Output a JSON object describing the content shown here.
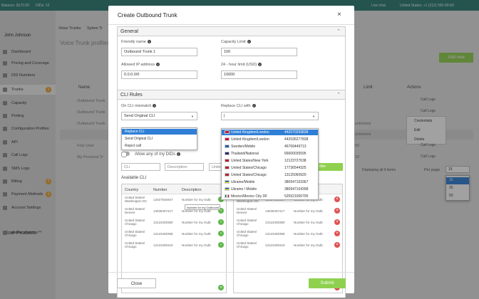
{
  "topbar": {
    "balance": "Balance: $170.00",
    "dids": "DIDs: 12",
    "live_chat": "Live chat",
    "phone": "United States: +1 (212) 555-90-60"
  },
  "sidebar": {
    "user": "John Johnson",
    "items": [
      {
        "label": "Dashboard"
      },
      {
        "label": "Pricing and Coverage"
      },
      {
        "label": "DID Numbers"
      },
      {
        "label": "Trunks",
        "badge": "1"
      },
      {
        "label": "Capacity"
      },
      {
        "label": "Porting"
      },
      {
        "label": "Configuration Profiles"
      },
      {
        "label": "API"
      },
      {
        "label": "Call Logs"
      },
      {
        "label": "SMS Logs"
      },
      {
        "label": "Billing",
        "badge": "2"
      },
      {
        "label": "Payment Methods",
        "badge": "1"
      },
      {
        "label": "Account Settings"
      }
    ],
    "more": "More Products",
    "more_item": "phone.systems™"
  },
  "background": {
    "tabs": [
      "Voice Trunks",
      "Sytem Tr"
    ],
    "title": "Voice Trunk profiles",
    "add_new": "Add new",
    "col_name": "Name",
    "col_limit": "Limit",
    "col_actions": "Actions",
    "rows": [
      "Outbound Trunk",
      "Outbound Trunk",
      "Outbound Trunk",
      "",
      "First User",
      "My Personal Tr"
    ],
    "limits": [
      "",
      "",
      "unlimited",
      "unlimited",
      "50",
      "10"
    ],
    "call_logs": "Call Logs",
    "menu": [
      "Credentials",
      "Edit",
      "Delete"
    ],
    "per_page_label": "Per page",
    "per_page_value": "15",
    "per_page_options": [
      "15",
      "25",
      "50"
    ],
    "displaying": "Displaying all 6 items"
  },
  "modal": {
    "title": "Create Outbound Trunk",
    "close_icon": "×",
    "general": "General",
    "friendly_name_label": "Friendly name",
    "friendly_name_value": "Outbound Trunk 1",
    "capacity_label": "Capacity Limit",
    "capacity_value": "100",
    "ip_label": "Allowed IP address",
    "ip_value": "0.0.0.0/0",
    "limit_label": "24 - hour limit (USD)",
    "limit_value": "10000",
    "cli_rules": "CLI Rules",
    "mismatch_label": "On CLI mismatch",
    "mismatch_value": "Send Original CLI",
    "mismatch_options": [
      "Replace CLI",
      "Send Original CLI",
      "Reject call"
    ],
    "replace_label": "Replace CLI with",
    "replace_value": "|",
    "replace_options": [
      {
        "country": "United Kingdom/London",
        "number": "442070259838"
      },
      {
        "country": "United Kingdom/London",
        "number": "442036277838"
      },
      {
        "country": "Sweden/Mobile",
        "number": "46769449713"
      },
      {
        "country": "Thailand/National",
        "number": "66600035595"
      },
      {
        "country": "United States/New York",
        "number": "12123727638"
      },
      {
        "country": "United States/Chicago",
        "number": "17736544325"
      },
      {
        "country": "United States/Chicago",
        "number": "13125060920"
      },
      {
        "country": "Ukraine/Mobile",
        "number": "380947103367"
      },
      {
        "country": "Ukraine / Mobile",
        "number": "380947104398"
      },
      {
        "country": "Mexico/Mexico City DF",
        "number": "525521000795"
      }
    ],
    "allow_dids": "Allow any of my DIDs",
    "cli_placeholder": "CLI",
    "desc_placeholder": "Description",
    "country_placeholder": "Unite",
    "filter_btn": "Filter",
    "available_cli": "Available CLI",
    "col_country": "Country",
    "col_number": "Number",
    "col_description": "Description",
    "left_rows": [
      {
        "country": "United States/ Washington DC",
        "number": "12027548467",
        "desc": "Number for my Outb"
      },
      {
        "country": "United States/ Denver",
        "number": "13035407417",
        "desc": "Number for my Outb"
      },
      {
        "country": "United States/ Chicago",
        "number": "13123400380",
        "desc": "Number for my Outb"
      },
      {
        "country": "United States/ Chicago",
        "number": "13123400368",
        "desc": "Number for my Outb"
      },
      {
        "country": "United States/ Chicago",
        "number": "13123400418",
        "desc": "Number for my Outb"
      }
    ],
    "tooltip": "Number for my Outbound",
    "right_rows": [
      {
        "country": "United States/ Washington DC",
        "number": "12027548467",
        "desc": "Number for my Outb"
      },
      {
        "country": "United States/ Denver",
        "number": "13035407417",
        "desc": "Number for my Outb"
      },
      {
        "country": "United States/ Chicago",
        "number": "13123400380",
        "desc": "Number for my Outb"
      },
      {
        "country": "United States/ Chicago",
        "number": "13123400368",
        "desc": "Number for my Outb"
      },
      {
        "country": "United States/ Chicago",
        "number": "13123400418",
        "desc": "Number for my Outb"
      }
    ],
    "close_btn": "Close",
    "submit_btn": "Submit"
  },
  "colors": {
    "teal": "#2a7a72",
    "green": "#8fd14f",
    "blue": "#2f7fd6"
  }
}
